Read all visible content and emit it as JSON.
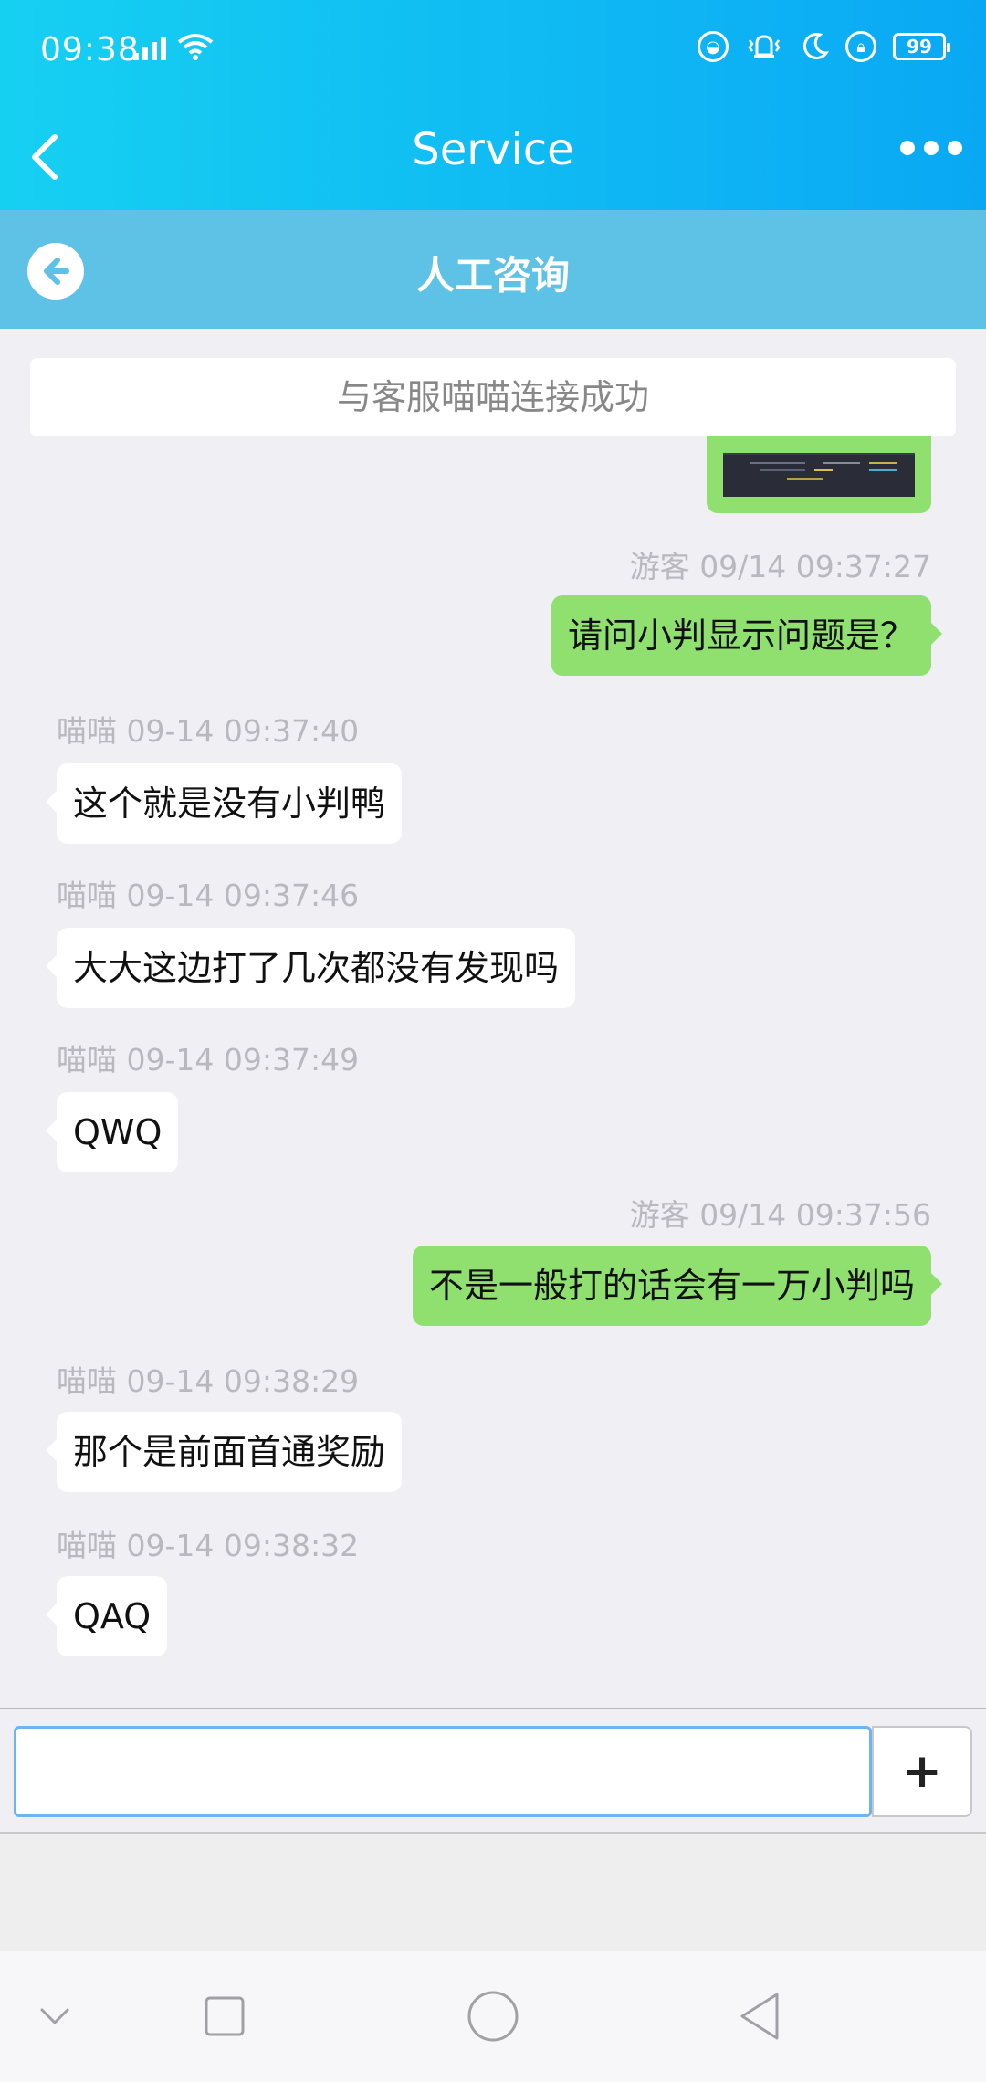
{
  "status_bar": {
    "time": "09:38",
    "battery": "99",
    "icons": [
      "signal-icon",
      "wifi-icon",
      "data-saver-icon",
      "vibrate-icon",
      "moon-icon",
      "lock-rotation-icon",
      "battery-icon"
    ]
  },
  "header": {
    "title": "Service",
    "back_icon": "chevron-left-icon",
    "more_icon": "more-dots-icon"
  },
  "subheader": {
    "title": "人工咨询",
    "back_icon": "circle-arrow-left-icon"
  },
  "notice": "与客服喵喵连接成功",
  "messages": [
    {
      "side": "right",
      "type": "image",
      "sender": "",
      "time": ""
    },
    {
      "side": "right",
      "sender": "游客",
      "time": "09/14 09:37:27",
      "text": "请问小判显示问题是？"
    },
    {
      "side": "left",
      "sender": "喵喵",
      "time": "09-14 09:37:40",
      "text": "这个就是没有小判鸭"
    },
    {
      "side": "left",
      "sender": "喵喵",
      "time": "09-14 09:37:46",
      "text": "大大这边打了几次都没有发现吗"
    },
    {
      "side": "left",
      "sender": "喵喵",
      "time": "09-14 09:37:49",
      "text": "QWQ"
    },
    {
      "side": "right",
      "sender": "游客",
      "time": "09/14 09:37:56",
      "text": "不是一般打的话会有一万小判吗"
    },
    {
      "side": "left",
      "sender": "喵喵",
      "time": "09-14 09:38:29",
      "text": "那个是前面首通奖励"
    },
    {
      "side": "left",
      "sender": "喵喵",
      "time": "09-14 09:38:32",
      "text": "QAQ"
    }
  ],
  "input": {
    "value": "",
    "plus_label": "+"
  },
  "colors": {
    "header_gradient_start": "#16d0f2",
    "header_gradient_end": "#0aa8f4",
    "subheader": "#5ec2e6",
    "my_bubble": "#8fe06f",
    "their_bubble": "#ffffff",
    "background": "#efeff4"
  },
  "nav_bar": {
    "icons": [
      "chevron-down-icon",
      "recents-square-icon",
      "home-circle-icon",
      "back-triangle-icon"
    ]
  }
}
